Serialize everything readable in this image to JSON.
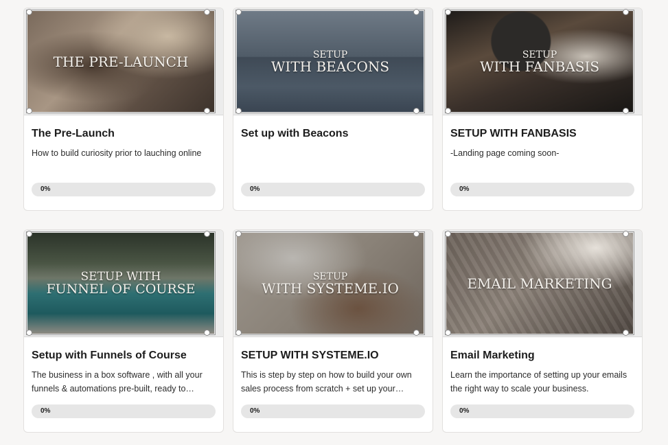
{
  "courses": [
    {
      "thumb_line1": "",
      "thumb_line2": "THE PRE-LAUNCH",
      "title": "The Pre-Launch",
      "description": "How to build curiosity prior to lauching online",
      "progress_label": "0%",
      "progress": 0
    },
    {
      "thumb_line1": "SETUP",
      "thumb_line2": "WITH BEACONS",
      "title": "Set up with Beacons",
      "description": "",
      "progress_label": "0%",
      "progress": 0
    },
    {
      "thumb_line1": "SETUP",
      "thumb_line2": "WITH FANBASIS",
      "title": "SETUP WITH FANBASIS",
      "description": "-Landing page coming soon-",
      "progress_label": "0%",
      "progress": 0
    },
    {
      "thumb_line1": "SETUP WITH",
      "thumb_line2": "FUNNEL OF COURSE",
      "title": "Setup with Funnels of Course",
      "description": "The business in a box software , with all your funnels & automations pre-built, ready to…",
      "progress_label": "0%",
      "progress": 0
    },
    {
      "thumb_line1": "SETUP",
      "thumb_line2": "WITH SYSTEME.IO",
      "title": "SETUP WITH SYSTEME.IO",
      "description": "This is step by step on how to build your own sales process from scratch + set up your…",
      "progress_label": "0%",
      "progress": 0
    },
    {
      "thumb_line1": "",
      "thumb_line2": "EMAIL MARKETING",
      "title": "Email Marketing",
      "description": "Learn the importance of setting up your emails the right way to scale your business.",
      "progress_label": "0%",
      "progress": 0
    }
  ]
}
